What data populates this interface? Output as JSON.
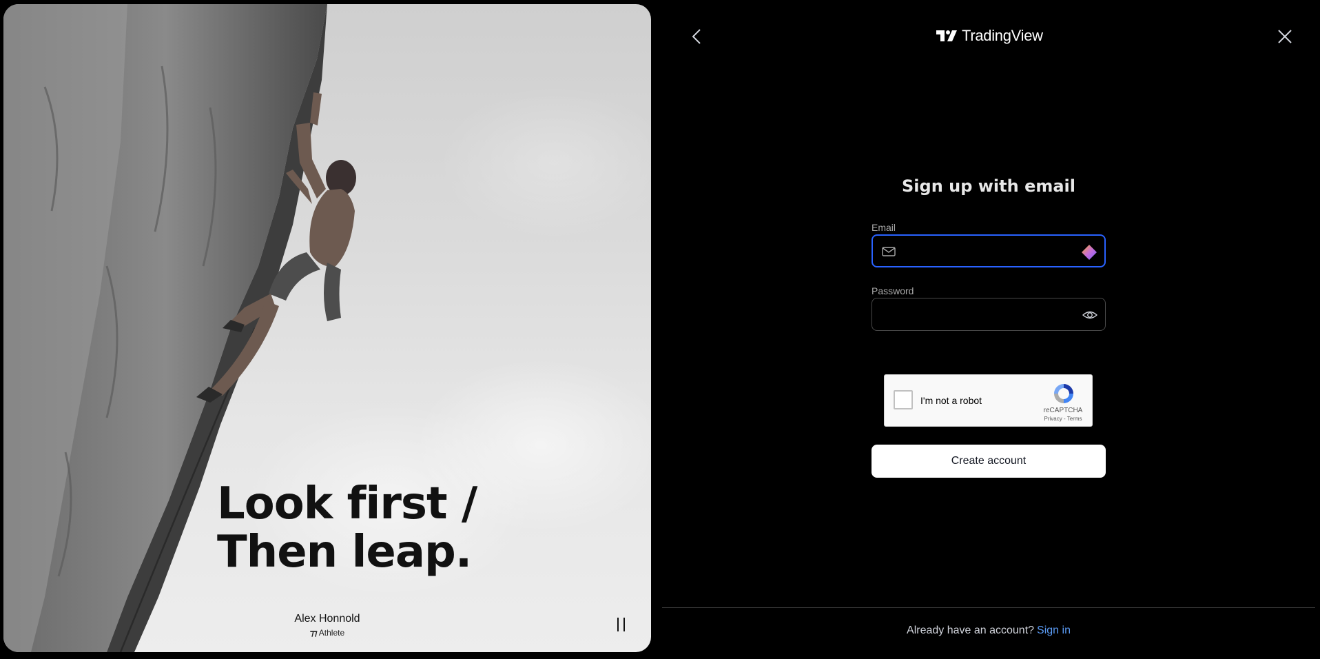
{
  "brand": {
    "name": "TradingView",
    "logo_icon": "tradingview-logo-icon"
  },
  "nav": {
    "back_icon": "chevron-left-icon",
    "close_icon": "close-icon"
  },
  "hero": {
    "headline": "Look first /\nThen leap.",
    "athlete_name": "Alex Honnold",
    "athlete_role": "Athlete",
    "pause_icon": "pause-icon"
  },
  "form": {
    "title": "Sign up with email",
    "email_label": "Email",
    "email_value": "",
    "email_icon": "mail-icon",
    "autofill_icon": "autofill-gem-icon",
    "password_label": "Password",
    "password_value": "",
    "show_password_icon": "eye-icon",
    "captcha": {
      "label": "I'm not a robot",
      "brand": "reCAPTCHA",
      "links": "Privacy - Terms",
      "checked": false
    },
    "submit_label": "Create account"
  },
  "footer": {
    "prompt": "Already have an account?",
    "link": "Sign in"
  },
  "colors": {
    "background": "#000000",
    "accent_focus": "#2962ff",
    "link": "#5b9cf6",
    "button_bg": "#ffffff"
  }
}
